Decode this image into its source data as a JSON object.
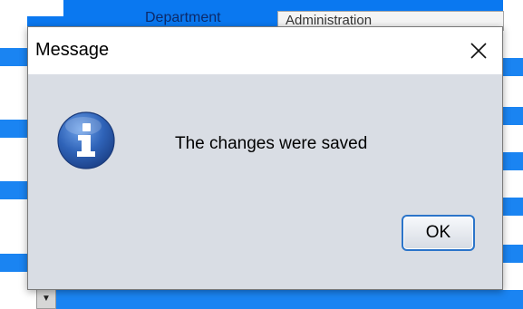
{
  "background": {
    "department_label": "Department",
    "department_value": "Administration"
  },
  "dialog": {
    "title": "Message",
    "close_icon": "close-icon",
    "info_icon": "information-icon",
    "message": "The changes were saved",
    "ok_label": "OK"
  },
  "colors": {
    "dialog_body": "#d9dde4",
    "titlebar": "#ffffff",
    "background_accent": "#0a78f0",
    "ok_button_border": "#2b74c9",
    "info_icon_blue": "#2f63b8"
  }
}
